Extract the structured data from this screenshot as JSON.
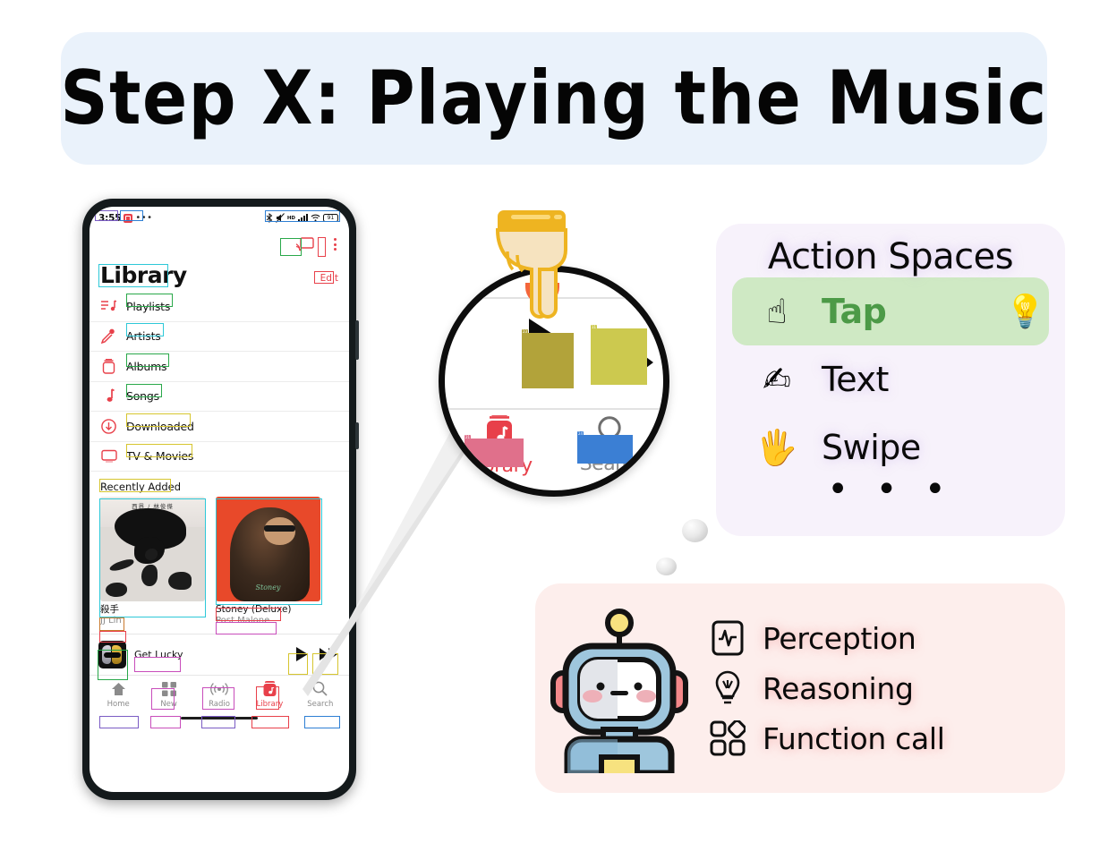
{
  "title": {
    "text": "Step X: Playing the Music",
    "bg": "#eaf2fb"
  },
  "phone": {
    "statusbar": {
      "time": "3:55",
      "alarm_icon": "alarm-icon",
      "more_icon": "ellipsis-icon",
      "bluetooth_icon": "bluetooth-icon",
      "mute_icon": "mute-icon",
      "hd_label": "HD",
      "signal_icon": "signal-bars-icon",
      "wifi_icon": "wifi-icon",
      "battery_level": "91"
    },
    "top_actions": {
      "airplay_icon": "airplay-icon",
      "more_icon": "kebab-menu-icon"
    },
    "header": {
      "title": "Library",
      "edit_label": "Edit"
    },
    "library_items": [
      {
        "label": "Playlists",
        "icon": "playlist-icon",
        "box": "#2aa84a"
      },
      {
        "label": "Artists",
        "icon": "microphone-icon",
        "box": "#2ec8d8"
      },
      {
        "label": "Albums",
        "icon": "album-icon",
        "box": "#2aa84a"
      },
      {
        "label": "Songs",
        "icon": "music-note-icon",
        "box": "#2aa84a"
      },
      {
        "label": "Downloaded",
        "icon": "download-icon",
        "box": "#d6c52e"
      },
      {
        "label": "TV & Movies",
        "icon": "tv-icon",
        "box": "#d6c52e"
      }
    ],
    "recently_added": {
      "heading": "Recently Added",
      "albums": [
        {
          "name": "殺手",
          "artist": "JJ Lin",
          "cover_text": "西界 / 林俊傑"
        },
        {
          "name": "Stoney (Deluxe)",
          "artist": "Post Malone",
          "cover_text": "Stoney"
        }
      ]
    },
    "now_playing": {
      "track": "Get Lucky",
      "artwork": "daft-punk-helmets",
      "play_icon": "play-icon",
      "forward_icon": "fast-forward-icon"
    },
    "tabs": [
      {
        "label": "Home",
        "icon": "home-icon",
        "active": false
      },
      {
        "label": "New",
        "icon": "grid-icon",
        "active": false
      },
      {
        "label": "Radio",
        "icon": "radio-icon",
        "active": false
      },
      {
        "label": "Library",
        "icon": "library-icon",
        "active": true
      },
      {
        "label": "Search",
        "icon": "search-icon",
        "active": false
      }
    ]
  },
  "magnifier": {
    "play_icon": "play-icon",
    "forward_icon": "fast-forward-icon",
    "library_label": "Library",
    "search_label": "Search",
    "library_icon": "library-icon",
    "search_icon": "search-icon",
    "tap_hand_icon": "pointing-hand-icon",
    "tap_ripple": "tap-ripple-indicator",
    "annotations": {
      "play_num": "23",
      "forward_num": "11",
      "library_num": "21",
      "search_num": "24"
    }
  },
  "action_panel": {
    "title": "Action Spaces",
    "bg": "#f7f2fb",
    "highlight_bg": "#cfe9c4",
    "highlight_text_color": "#4c9a47",
    "items": [
      {
        "label": "Tap",
        "emoji": "☝",
        "icon": "tap-hand-icon",
        "selected": true,
        "badge": "💡"
      },
      {
        "label": "Text",
        "emoji": "✍",
        "icon": "writing-hand-icon",
        "selected": false,
        "badge": ""
      },
      {
        "label": "Swipe",
        "emoji": "🖐",
        "icon": "swipe-hand-icon",
        "selected": false,
        "badge": ""
      }
    ],
    "ellipsis": "• • •"
  },
  "robot_panel": {
    "bg": "#fdeeec",
    "robot_icon": "robot-avatar",
    "capabilities": [
      {
        "label": "Perception",
        "icon": "waveform-monitor-icon"
      },
      {
        "label": "Reasoning",
        "icon": "lightbulb-outline-icon"
      },
      {
        "label": "Function call",
        "icon": "shapes-grid-icon"
      }
    ]
  }
}
